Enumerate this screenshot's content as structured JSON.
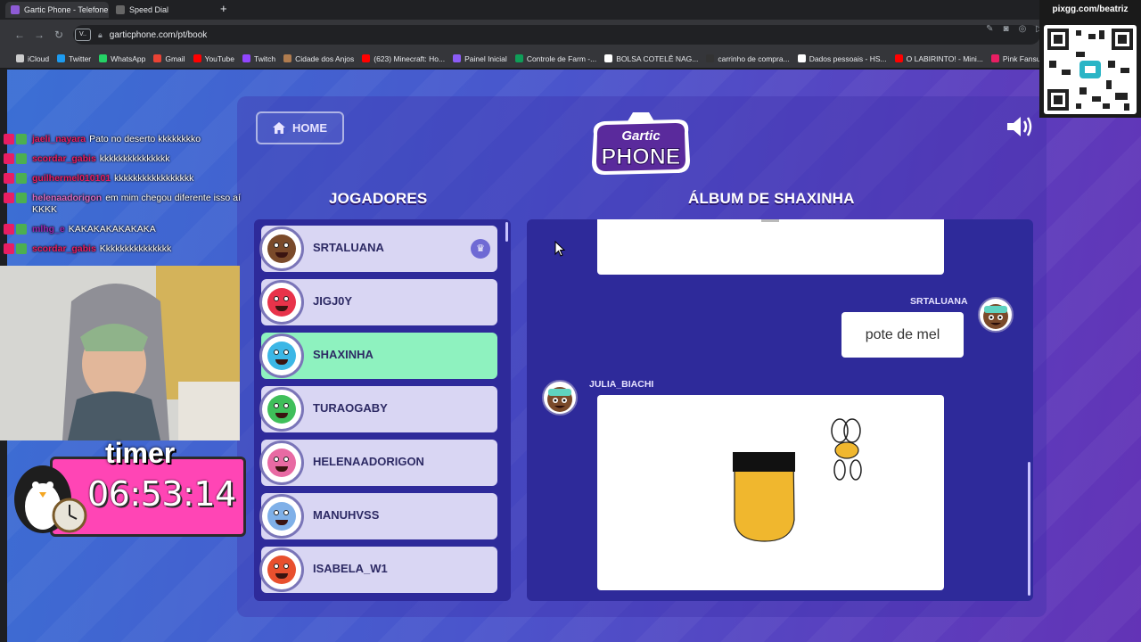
{
  "browser": {
    "tabs": [
      {
        "title": "Gartic Phone - Telefone se",
        "active": true
      },
      {
        "title": "Speed Dial",
        "active": false
      }
    ],
    "new_tab": "+",
    "url": "garticphone.com/pt/book",
    "url_badge": "V..",
    "bookmarks": [
      {
        "label": "iCloud",
        "color": "#cccccc"
      },
      {
        "label": "Twitter",
        "color": "#1d9bf0"
      },
      {
        "label": "WhatsApp",
        "color": "#25d366"
      },
      {
        "label": "Gmail",
        "color": "#ea4335"
      },
      {
        "label": "YouTube",
        "color": "#ff0000"
      },
      {
        "label": "Twitch",
        "color": "#9146ff"
      },
      {
        "label": "Cidade dos Anjos",
        "color": "#b07c4f"
      },
      {
        "label": "(623) Minecraft: Ho...",
        "color": "#ff0000"
      },
      {
        "label": "Painel Inicial",
        "color": "#8b5cf6"
      },
      {
        "label": "Controle de Farm -...",
        "color": "#0f9d58"
      },
      {
        "label": "BOLSA COTELÊ NAG...",
        "color": "#ffffff"
      },
      {
        "label": "carrinho de compra...",
        "color": "#333333"
      },
      {
        "label": "Dados pessoais - HS...",
        "color": "#ffffff"
      },
      {
        "label": "O LABIRINTO! - Mini...",
        "color": "#ff0000"
      },
      {
        "label": "Pink Fansub",
        "color": "#e91e63"
      }
    ]
  },
  "game": {
    "home_label": "HOME",
    "logo_top": "Gartic",
    "logo_bottom": "PHONE",
    "players_title": "JOGADORES",
    "album_title": "ÁLBUM DE SHAXINHA",
    "players": [
      {
        "name": "SRTALUANA",
        "color": "#7a4a2a",
        "host": true,
        "highlight": false
      },
      {
        "name": "JIGJ0Y",
        "color": "#e8334a",
        "host": false,
        "highlight": false
      },
      {
        "name": "SHAXINHA",
        "color": "#3cb7e6",
        "host": false,
        "highlight": true
      },
      {
        "name": "TURAOGABY",
        "color": "#3fbf5a",
        "host": false,
        "highlight": false
      },
      {
        "name": "HELENAADORIGON",
        "color": "#e86aa3",
        "host": false,
        "highlight": false
      },
      {
        "name": "MANUHVSS",
        "color": "#7fb0e8",
        "host": false,
        "highlight": false
      },
      {
        "name": "ISABELA_W1",
        "color": "#e8502e",
        "host": false,
        "highlight": false
      }
    ],
    "album": {
      "message_author": "SRTALUANA",
      "message_text": "pote de mel",
      "drawing_author": "JULIA_BIACHI"
    }
  },
  "stream": {
    "chat": [
      {
        "user": "jaeli_nayara",
        "text": "Pato no deserto kkkkkkkko",
        "color": "#e91e63"
      },
      {
        "user": "scordar_gabis",
        "text": "kkkkkkkkkkkkkkk",
        "color": "#e91e63"
      },
      {
        "user": "guilhermel010101",
        "text": "kkkkkkkkkkkkkkkkk",
        "color": "#e91e63"
      },
      {
        "user": "helenaadorigon",
        "text": "em mim chegou diferente isso aí KKKK",
        "color": "#d86ac0"
      },
      {
        "user": "mlhg_e",
        "text": "KAKAKAKAKAKAKA",
        "color": "#9c27b0"
      },
      {
        "user": "scordar_gabis",
        "text": "Kkkkkkkkkkkkkkk",
        "color": "#e91e63"
      }
    ],
    "timer_label": "timer",
    "timer_value": "06:53:14",
    "qr_label": "pixgg.com/beatriz"
  }
}
